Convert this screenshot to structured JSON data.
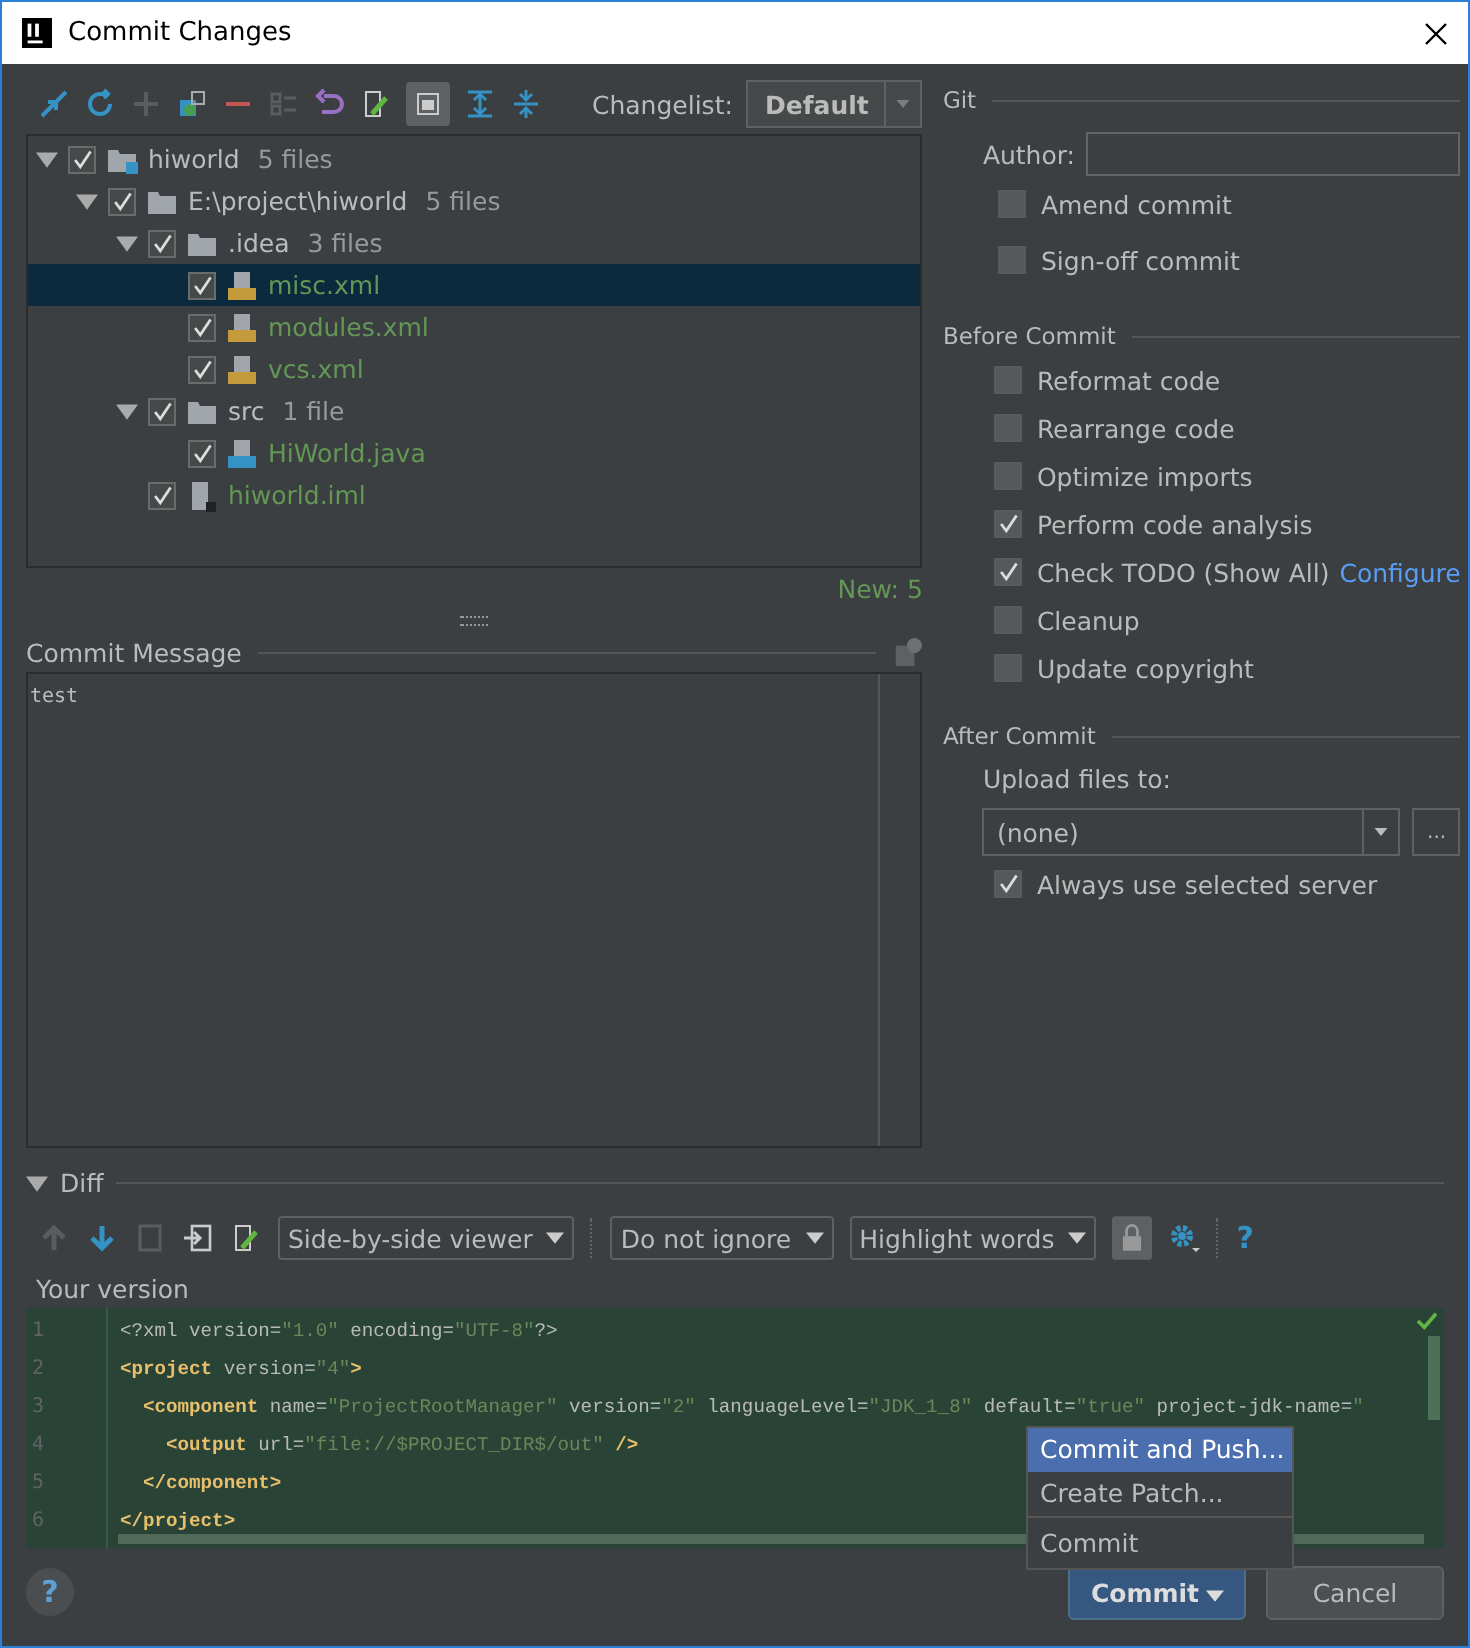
{
  "window": {
    "title": "Commit Changes"
  },
  "changelist": {
    "label": "Changelist:",
    "value": "Default"
  },
  "tree": [
    {
      "name": "hiworld",
      "count": "5 files",
      "kind": "module",
      "checked": true,
      "expanded": true,
      "selected": false,
      "new": false,
      "children": [
        {
          "name": "E:\\project\\hiworld",
          "count": "5 files",
          "kind": "folder",
          "checked": true,
          "expanded": true,
          "selected": false,
          "new": false,
          "children": [
            {
              "name": ".idea",
              "count": "3 files",
              "kind": "folder",
              "checked": true,
              "expanded": true,
              "selected": false,
              "new": false,
              "children": [
                {
                  "name": "misc.xml",
                  "kind": "xml",
                  "checked": true,
                  "selected": true,
                  "new": true
                },
                {
                  "name": "modules.xml",
                  "kind": "xml",
                  "checked": true,
                  "selected": false,
                  "new": true
                },
                {
                  "name": "vcs.xml",
                  "kind": "xml",
                  "checked": true,
                  "selected": false,
                  "new": true
                }
              ]
            },
            {
              "name": "src",
              "count": "1 file",
              "kind": "folder",
              "checked": true,
              "expanded": true,
              "selected": false,
              "new": false,
              "children": [
                {
                  "name": "HiWorld.java",
                  "kind": "java",
                  "checked": true,
                  "selected": false,
                  "new": true
                }
              ]
            },
            {
              "name": "hiworld.iml",
              "kind": "iml",
              "checked": true,
              "selected": false,
              "new": true
            }
          ]
        }
      ]
    }
  ],
  "summary": "New: 5",
  "commit_message": {
    "label": "Commit Message",
    "value": "test"
  },
  "git": {
    "title": "Git",
    "author_label": "Author:",
    "options": [
      {
        "label": "Amend commit",
        "checked": false
      },
      {
        "label": "Sign-off commit",
        "checked": false
      }
    ]
  },
  "before_commit": {
    "title": "Before Commit",
    "options": [
      {
        "label": "Reformat code",
        "checked": false
      },
      {
        "label": "Rearrange code",
        "checked": false
      },
      {
        "label": "Optimize imports",
        "checked": false
      },
      {
        "label": "Perform code analysis",
        "checked": true
      },
      {
        "label": "Check TODO (Show All)",
        "checked": true,
        "link": "Configure"
      },
      {
        "label": "Cleanup",
        "checked": false
      },
      {
        "label": "Update copyright",
        "checked": false
      }
    ]
  },
  "after_commit": {
    "title": "After Commit",
    "upload_label": "Upload files to:",
    "server": "(none)",
    "more": "...",
    "always": {
      "label": "Always use selected server",
      "checked": true
    }
  },
  "diff": {
    "title": "Diff",
    "expanded": true,
    "viewer": "Side-by-side viewer",
    "ignore": "Do not ignore",
    "highlight": "Highlight words",
    "help": "?",
    "version_label": "Your version",
    "lines": [
      {
        "number": "1",
        "tokens": [
          {
            "text": "<?xml version=",
            "kind": "plain"
          },
          {
            "text": "\"1.0\"",
            "kind": "value"
          },
          {
            "text": " encoding=",
            "kind": "plain"
          },
          {
            "text": "\"UTF-8\"",
            "kind": "value"
          },
          {
            "text": "?>",
            "kind": "plain"
          }
        ]
      },
      {
        "number": "2",
        "tokens": [
          {
            "text": "<project",
            "kind": "tag"
          },
          {
            "text": " version=",
            "kind": "attr"
          },
          {
            "text": "\"4\"",
            "kind": "value"
          },
          {
            "text": ">",
            "kind": "tag"
          }
        ]
      },
      {
        "number": "3",
        "tokens": [
          {
            "text": "  <component",
            "kind": "tag"
          },
          {
            "text": " name=",
            "kind": "attr"
          },
          {
            "text": "\"ProjectRootManager\"",
            "kind": "value"
          },
          {
            "text": " version=",
            "kind": "attr"
          },
          {
            "text": "\"2\"",
            "kind": "value"
          },
          {
            "text": " languageLevel=",
            "kind": "attr"
          },
          {
            "text": "\"JDK_1_8\"",
            "kind": "value"
          },
          {
            "text": " default=",
            "kind": "attr"
          },
          {
            "text": "\"true\"",
            "kind": "value"
          },
          {
            "text": " project-jdk-name=",
            "kind": "attr"
          },
          {
            "text": "\"",
            "kind": "value"
          }
        ]
      },
      {
        "number": "4",
        "tokens": [
          {
            "text": "    <output",
            "kind": "tag"
          },
          {
            "text": " url=",
            "kind": "attr"
          },
          {
            "text": "\"file://$PROJECT_DIR$/out\"",
            "kind": "value"
          },
          {
            "text": " />",
            "kind": "tag"
          }
        ]
      },
      {
        "number": "5",
        "tokens": [
          {
            "text": "  </component>",
            "kind": "tag"
          }
        ]
      },
      {
        "number": "6",
        "tokens": [
          {
            "text": "</project>",
            "kind": "tag"
          }
        ]
      }
    ]
  },
  "menu": [
    {
      "label": "Commit and Push...",
      "selected": true
    },
    {
      "label": "Create Patch...",
      "selected": false
    },
    {
      "label": "Commit",
      "selected": false
    }
  ],
  "help": "?",
  "buttons": [
    {
      "label": "Commit",
      "kind": "primary"
    },
    {
      "label": "Cancel",
      "kind": "normal"
    }
  ]
}
